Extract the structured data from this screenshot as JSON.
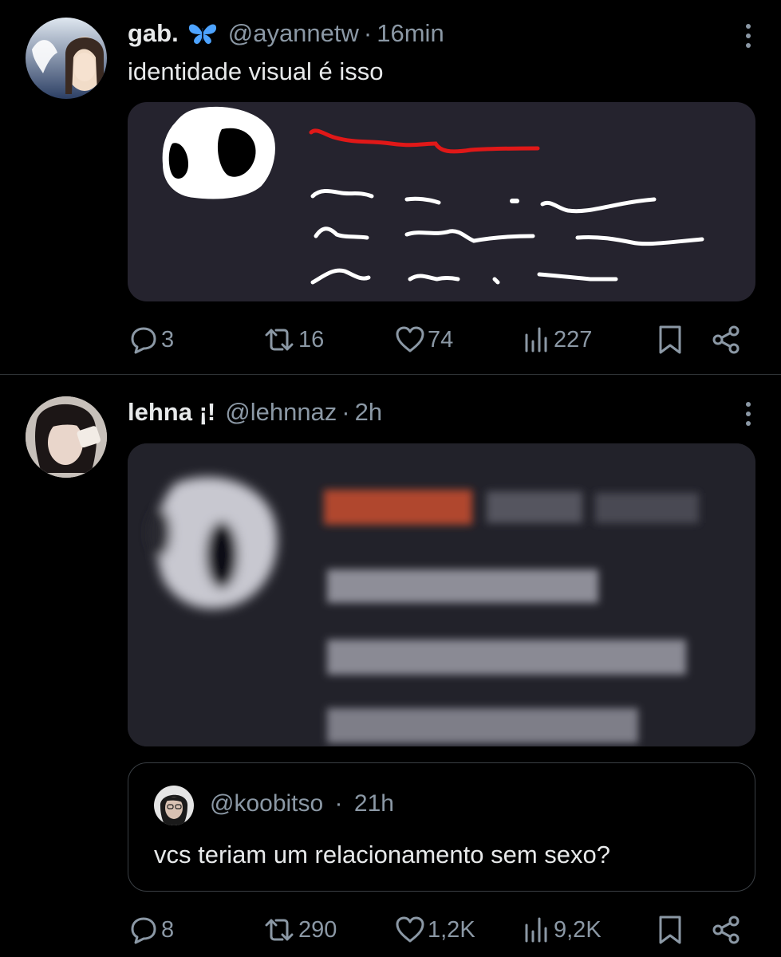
{
  "tweets": [
    {
      "name": "gab.",
      "badge_icon": "butterfly-emoji",
      "handle": "@ayannetw",
      "separator": "·",
      "time": "16min",
      "text": "identidade visual é isso",
      "actions": {
        "replies": "3",
        "reposts": "16",
        "likes": "74",
        "views": "227"
      }
    },
    {
      "name": "lehna ¡!",
      "handle": "@lehnnaz",
      "separator": "·",
      "time": "2h",
      "quote": {
        "handle": "@koobitso",
        "separator": "·",
        "time": "21h",
        "text": "vcs teriam um relacionamento sem sexo?"
      },
      "actions": {
        "replies": "8",
        "reposts": "290",
        "likes": "1,2K",
        "views": "9,2K"
      }
    }
  ],
  "colors": {
    "background": "#000000",
    "muted": "#8b98a5",
    "text": "#e7e9ea",
    "media_bg": "#25232e",
    "red_scribble": "#e01818"
  }
}
